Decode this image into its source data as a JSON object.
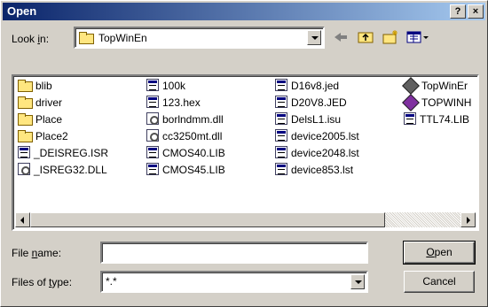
{
  "dialog": {
    "title": "Open",
    "help_label": "?",
    "close_label": "×"
  },
  "lookin": {
    "label_prefix": "Look ",
    "label_u": "i",
    "label_suffix": "n:",
    "value": "TopWinEn"
  },
  "toolbar": {
    "icons": [
      "back-arrow-icon",
      "up-folder-icon",
      "new-folder-icon",
      "view-menu-icon"
    ]
  },
  "files": {
    "col1": [
      {
        "name": "blib",
        "icon": "folder"
      },
      {
        "name": "driver",
        "icon": "folder"
      },
      {
        "name": "Place",
        "icon": "folder"
      },
      {
        "name": "Place2",
        "icon": "folder"
      },
      {
        "name": "_DEISREG.ISR",
        "icon": "file"
      },
      {
        "name": "_ISREG32.DLL",
        "icon": "dll"
      }
    ],
    "col2": [
      {
        "name": "100k",
        "icon": "file"
      },
      {
        "name": "123.hex",
        "icon": "file"
      },
      {
        "name": "borlndmm.dll",
        "icon": "dll"
      },
      {
        "name": "cc3250mt.dll",
        "icon": "dll"
      },
      {
        "name": "CMOS40.LIB",
        "icon": "file"
      },
      {
        "name": "CMOS45.LIB",
        "icon": "file"
      }
    ],
    "col3": [
      {
        "name": "D16v8.jed",
        "icon": "file"
      },
      {
        "name": "D20V8.JED",
        "icon": "file"
      },
      {
        "name": "DelsL1.isu",
        "icon": "file"
      },
      {
        "name": "device2005.lst",
        "icon": "file"
      },
      {
        "name": "device2048.lst",
        "icon": "file"
      },
      {
        "name": "device853.lst",
        "icon": "file"
      }
    ],
    "col4": [
      {
        "name": "TopWinEr",
        "icon": "app"
      },
      {
        "name": "TOPWINH",
        "icon": "app-purple"
      },
      {
        "name": "TTL74.LIB",
        "icon": "file"
      }
    ]
  },
  "filename": {
    "label_prefix": "File ",
    "label_u": "n",
    "label_suffix": "ame:",
    "value": ""
  },
  "filetype": {
    "label_prefix": "Files of ",
    "label_u": "t",
    "label_suffix": "ype:",
    "value": "*.*"
  },
  "buttons": {
    "open_u": "O",
    "open_rest": "pen",
    "cancel": "Cancel"
  }
}
